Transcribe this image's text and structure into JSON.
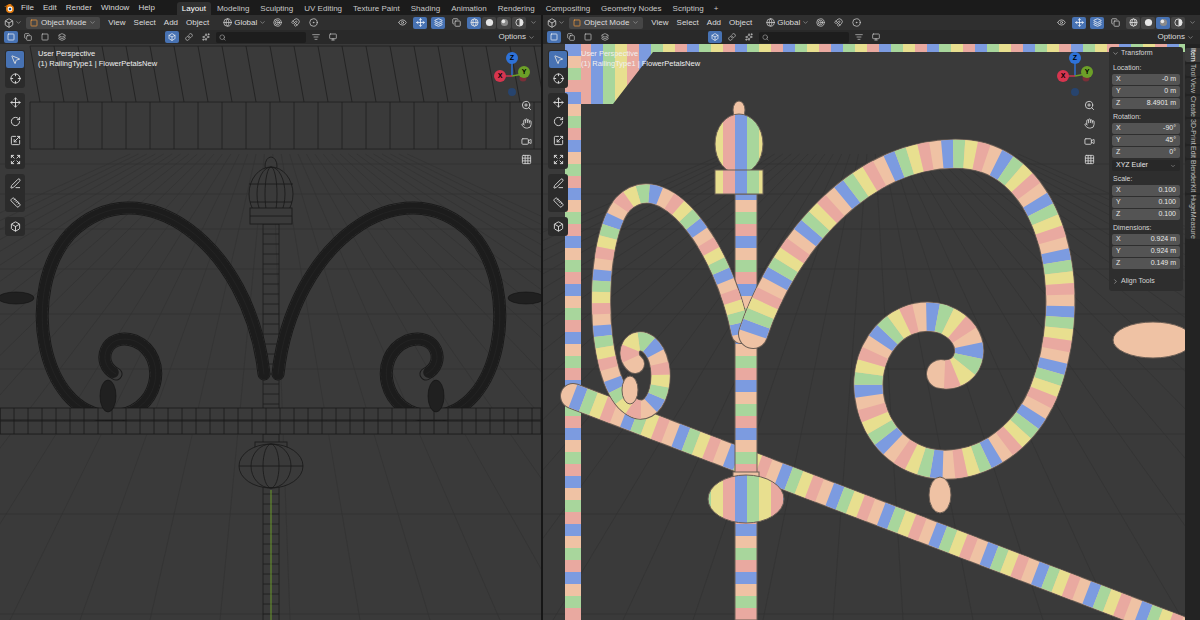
{
  "app_menu": [
    "File",
    "Edit",
    "Render",
    "Window",
    "Help"
  ],
  "workspaces": [
    {
      "label": "Layout",
      "selected": true
    },
    {
      "label": "Modeling",
      "selected": false
    },
    {
      "label": "Sculpting",
      "selected": false
    },
    {
      "label": "UV Editing",
      "selected": false
    },
    {
      "label": "Texture Paint",
      "selected": false
    },
    {
      "label": "Shading",
      "selected": false
    },
    {
      "label": "Animation",
      "selected": false
    },
    {
      "label": "Rendering",
      "selected": false
    },
    {
      "label": "Compositing",
      "selected": false
    },
    {
      "label": "Geometry Nodes",
      "selected": false
    },
    {
      "label": "Scripting",
      "selected": false
    }
  ],
  "add_workspace": "+",
  "viewports": [
    {
      "mode": "Object Mode",
      "menus": [
        "View",
        "Select",
        "Add",
        "Object"
      ],
      "orientation": "Global",
      "options": "Options",
      "view_name": "User Perspective",
      "object_info": "(1) RailingType1 | FlowerPetalsNew",
      "shading": "wireframe",
      "gizmo": {
        "x": "X",
        "y": "Y",
        "z": "Z"
      }
    },
    {
      "mode": "Object Mode",
      "menus": [
        "View",
        "Select",
        "Add",
        "Object"
      ],
      "orientation": "Global",
      "options": "Options",
      "view_name": "User Perspective",
      "object_info": "(1) RailingType1 | FlowerPetalsNew",
      "shading": "material",
      "gizmo": {
        "x": "X",
        "y": "Y",
        "z": "Z"
      }
    }
  ],
  "sidebar": {
    "tabs": [
      {
        "label": "Item",
        "selected": true
      },
      {
        "label": "Tool",
        "selected": false
      },
      {
        "label": "View",
        "selected": false
      },
      {
        "label": "Create",
        "selected": false
      },
      {
        "label": "3D-Print",
        "selected": false
      },
      {
        "label": "Edit",
        "selected": false
      },
      {
        "label": "BlenderKit",
        "selected": false
      },
      {
        "label": "HugeMeasure",
        "selected": false
      }
    ],
    "panel_title": "Transform",
    "panel_expanded": true,
    "groups": [
      {
        "label": "Location:",
        "fields": [
          {
            "axis": "X",
            "value": "-0 m"
          },
          {
            "axis": "Y",
            "value": "0 m"
          },
          {
            "axis": "Z",
            "value": "8.4901 m"
          }
        ]
      },
      {
        "label": "Rotation:",
        "fields": [
          {
            "axis": "X",
            "value": "-90°"
          },
          {
            "axis": "Y",
            "value": "45°"
          },
          {
            "axis": "Z",
            "value": "0°"
          }
        ],
        "dropdown": "XYZ Euler"
      },
      {
        "label": "Scale:",
        "fields": [
          {
            "axis": "X",
            "value": "0.100"
          },
          {
            "axis": "Y",
            "value": "0.100"
          },
          {
            "axis": "Z",
            "value": "0.100"
          }
        ]
      },
      {
        "label": "Dimensions:",
        "fields": [
          {
            "axis": "X",
            "value": "0.924 m"
          },
          {
            "axis": "Y",
            "value": "0.924 m"
          },
          {
            "axis": "Z",
            "value": "0.149 m"
          }
        ]
      }
    ],
    "subpanel": {
      "label": "Align Tools",
      "expanded": false
    }
  }
}
